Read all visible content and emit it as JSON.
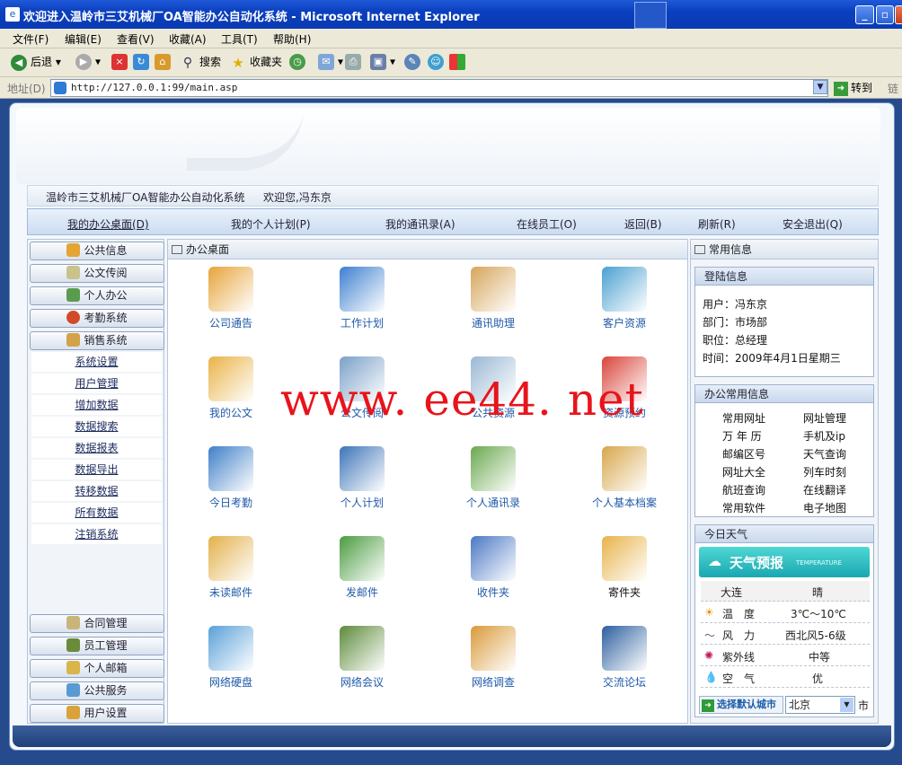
{
  "window": {
    "title": "欢迎进入温岭市三艾机械厂OA智能办公自动化系统 - Microsoft Internet Explorer",
    "minimize": "_",
    "close": "X"
  },
  "menu": [
    "文件(F)",
    "编辑(E)",
    "查看(V)",
    "收藏(A)",
    "工具(T)",
    "帮助(H)"
  ],
  "toolbar": {
    "back": "后退",
    "search": "搜索",
    "favorites": "收藏夹"
  },
  "address": {
    "label": "地址(D)",
    "url": "http://127.0.0.1:99/main.asp",
    "go": "转到",
    "links": "链"
  },
  "welcome": {
    "system": "温岭市三艾机械厂OA智能办公自动化系统",
    "greeting": "欢迎您,冯东京"
  },
  "nav": [
    "我的办公桌面(D)",
    "我的个人计划(P)",
    "我的通讯录(A)",
    "在线员工(O)",
    "返回(B)",
    "刷新(R)",
    "安全退出(Q)"
  ],
  "left_top": [
    "公共信息",
    "公文传阅",
    "个人办公",
    "考勤系统",
    "销售系统"
  ],
  "left_sub": [
    "系统设置",
    "用户管理",
    "增加数据",
    "数据搜索",
    "数据报表",
    "数据导出",
    "转移数据",
    "所有数据",
    "注销系统"
  ],
  "left_bottom": [
    "合同管理",
    "员工管理",
    "个人邮箱",
    "公共服务",
    "用户设置"
  ],
  "center": {
    "title": "办公桌面",
    "apps": [
      "公司通告",
      "工作计划",
      "通讯助理",
      "客户资源",
      "我的公文",
      "公文传阅",
      "公共资源",
      "资源预约",
      "今日考勤",
      "个人计划",
      "个人通讯录",
      "个人基本档案",
      "未读邮件",
      "发邮件",
      "收件夹",
      "寄件夹",
      "网络硬盘",
      "网络会议",
      "网络调查",
      "交流论坛"
    ]
  },
  "right": {
    "title": "常用信息",
    "login": {
      "title": "登陆信息",
      "user": "用户：冯东京",
      "dept": "部门：市场部",
      "role": "职位：总经理",
      "time": "时间：2009年4月1日星期三"
    },
    "info": {
      "title": "办公常用信息",
      "items": [
        "常用网址",
        "网址管理",
        "万 年 历",
        "手机及ip",
        "邮编区号",
        "天气查询",
        "网址大全",
        "列车时刻",
        "航班查询",
        "在线翻译",
        "常用软件",
        "电子地图"
      ]
    },
    "weather": {
      "title": "今日天气",
      "banner": "天气预报",
      "banner_sub": "TEMPERATURE",
      "city": "大连",
      "cond": "晴",
      "temp_l": "温　度",
      "temp_v": "3℃～10℃",
      "wind_l": "风　力",
      "wind_v": "西北风5-6级",
      "uv_l": "紫外线",
      "uv_v": "中等",
      "air_l": "空　气",
      "air_v": "优",
      "select_btn": "选择默认城市",
      "select_val": "北京",
      "suffix": "市"
    }
  },
  "watermark": "www. ee44. net"
}
